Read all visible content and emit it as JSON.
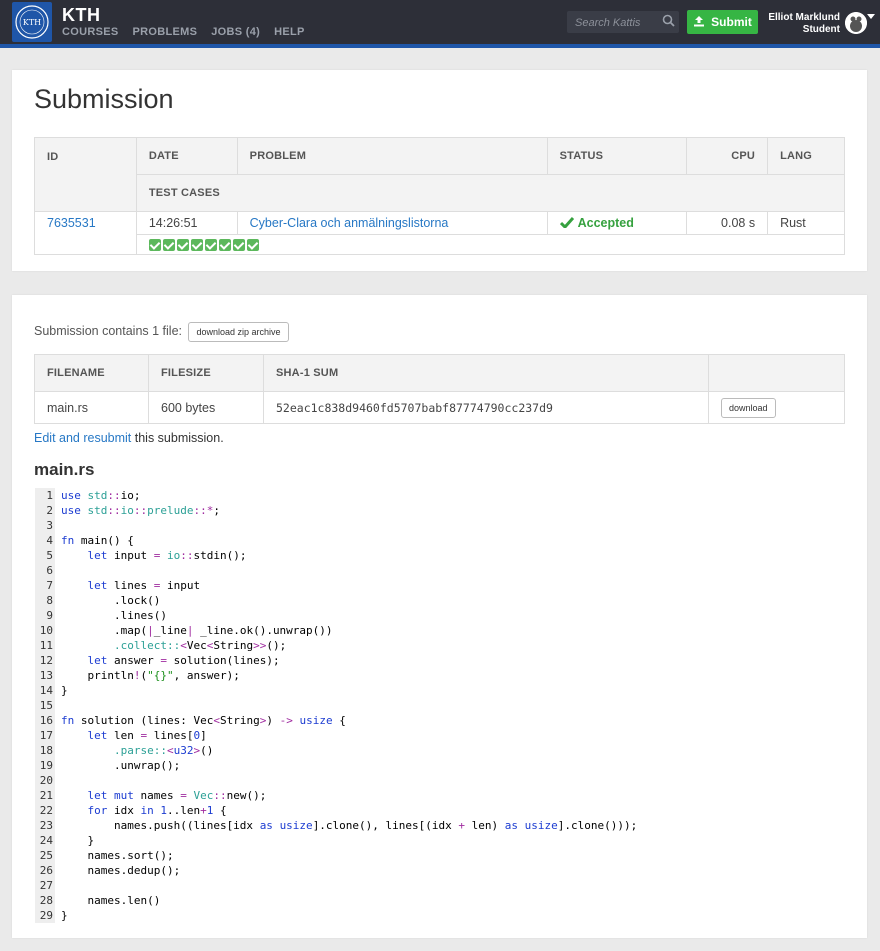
{
  "header": {
    "brand": "KTH",
    "nav": [
      "COURSES",
      "PROBLEMS",
      "JOBS (4)",
      "HELP"
    ],
    "search_placeholder": "Search Kattis",
    "submit_label": "Submit",
    "user_name": "Elliot Marklund",
    "user_role": "Student"
  },
  "submission": {
    "title": "Submission",
    "columns": [
      "ID",
      "DATE",
      "PROBLEM",
      "STATUS",
      "CPU",
      "LANG"
    ],
    "test_cases_label": "TEST CASES",
    "id": "7635531",
    "date": "14:26:51",
    "problem": "Cyber-Clara och anmälningslistorna",
    "status": "Accepted",
    "cpu": "0.08 s",
    "lang": "Rust",
    "test_cases_passed": 8
  },
  "files": {
    "intro": "Submission contains 1 file:",
    "zip_button": "download zip archive",
    "columns": [
      "FILENAME",
      "FILESIZE",
      "SHA-1 SUM",
      ""
    ],
    "rows": [
      {
        "filename": "main.rs",
        "filesize": "600 bytes",
        "sha1": "52eac1c838d9460fd5707babf87774790cc237d9",
        "download": "download"
      }
    ],
    "edit_link": "Edit and resubmit",
    "edit_suffix": " this submission."
  },
  "code": {
    "filename": "main.rs",
    "lines": [
      "use std::io;",
      "use std::io::prelude::*;",
      "",
      "fn main() {",
      "    let input = io::stdin();",
      "",
      "    let lines = input",
      "        .lock()",
      "        .lines()",
      "        .map(|_line| _line.ok().unwrap())",
      "        .collect::<Vec<String>>();",
      "    let answer = solution(lines);",
      "    println!(\"{}\", answer);",
      "}",
      "",
      "fn solution (lines: Vec<String>) -> usize {",
      "    let len = lines[0]",
      "        .parse::<u32>()",
      "        .unwrap();",
      "",
      "    let mut names = Vec::new();",
      "    for idx in 1..len+1 {",
      "        names.push((lines[idx as usize].clone(), lines[(idx + len) as usize].clone()));",
      "    }",
      "    names.sort();",
      "    names.dedup();",
      "",
      "    names.len()",
      "}"
    ]
  }
}
